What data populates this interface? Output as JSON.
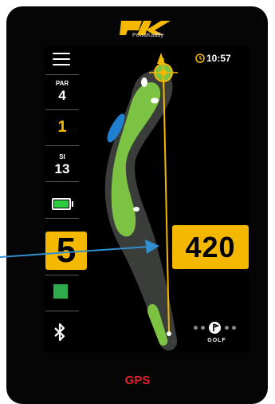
{
  "brand": {
    "logo_text": "PowaKaddy"
  },
  "status": {
    "time": "10:57"
  },
  "sidebar": {
    "par_label": "PAR",
    "par_value": "4",
    "hole_number": "1",
    "si_label": "SI",
    "si_value": "13",
    "battery_level": 1.0,
    "club": "5"
  },
  "main": {
    "distance": "420"
  },
  "pager": {
    "label": "GOLF",
    "pages": 5,
    "active_index": 2,
    "active_icon": "flag-icon"
  },
  "footer": {
    "mode_label": "GPS"
  },
  "colors": {
    "accent": "#f5b800",
    "fairway": "#7cc243",
    "water": "#1f7fd1",
    "gps": "#e0242a",
    "pointer": "#2f8fcf"
  }
}
